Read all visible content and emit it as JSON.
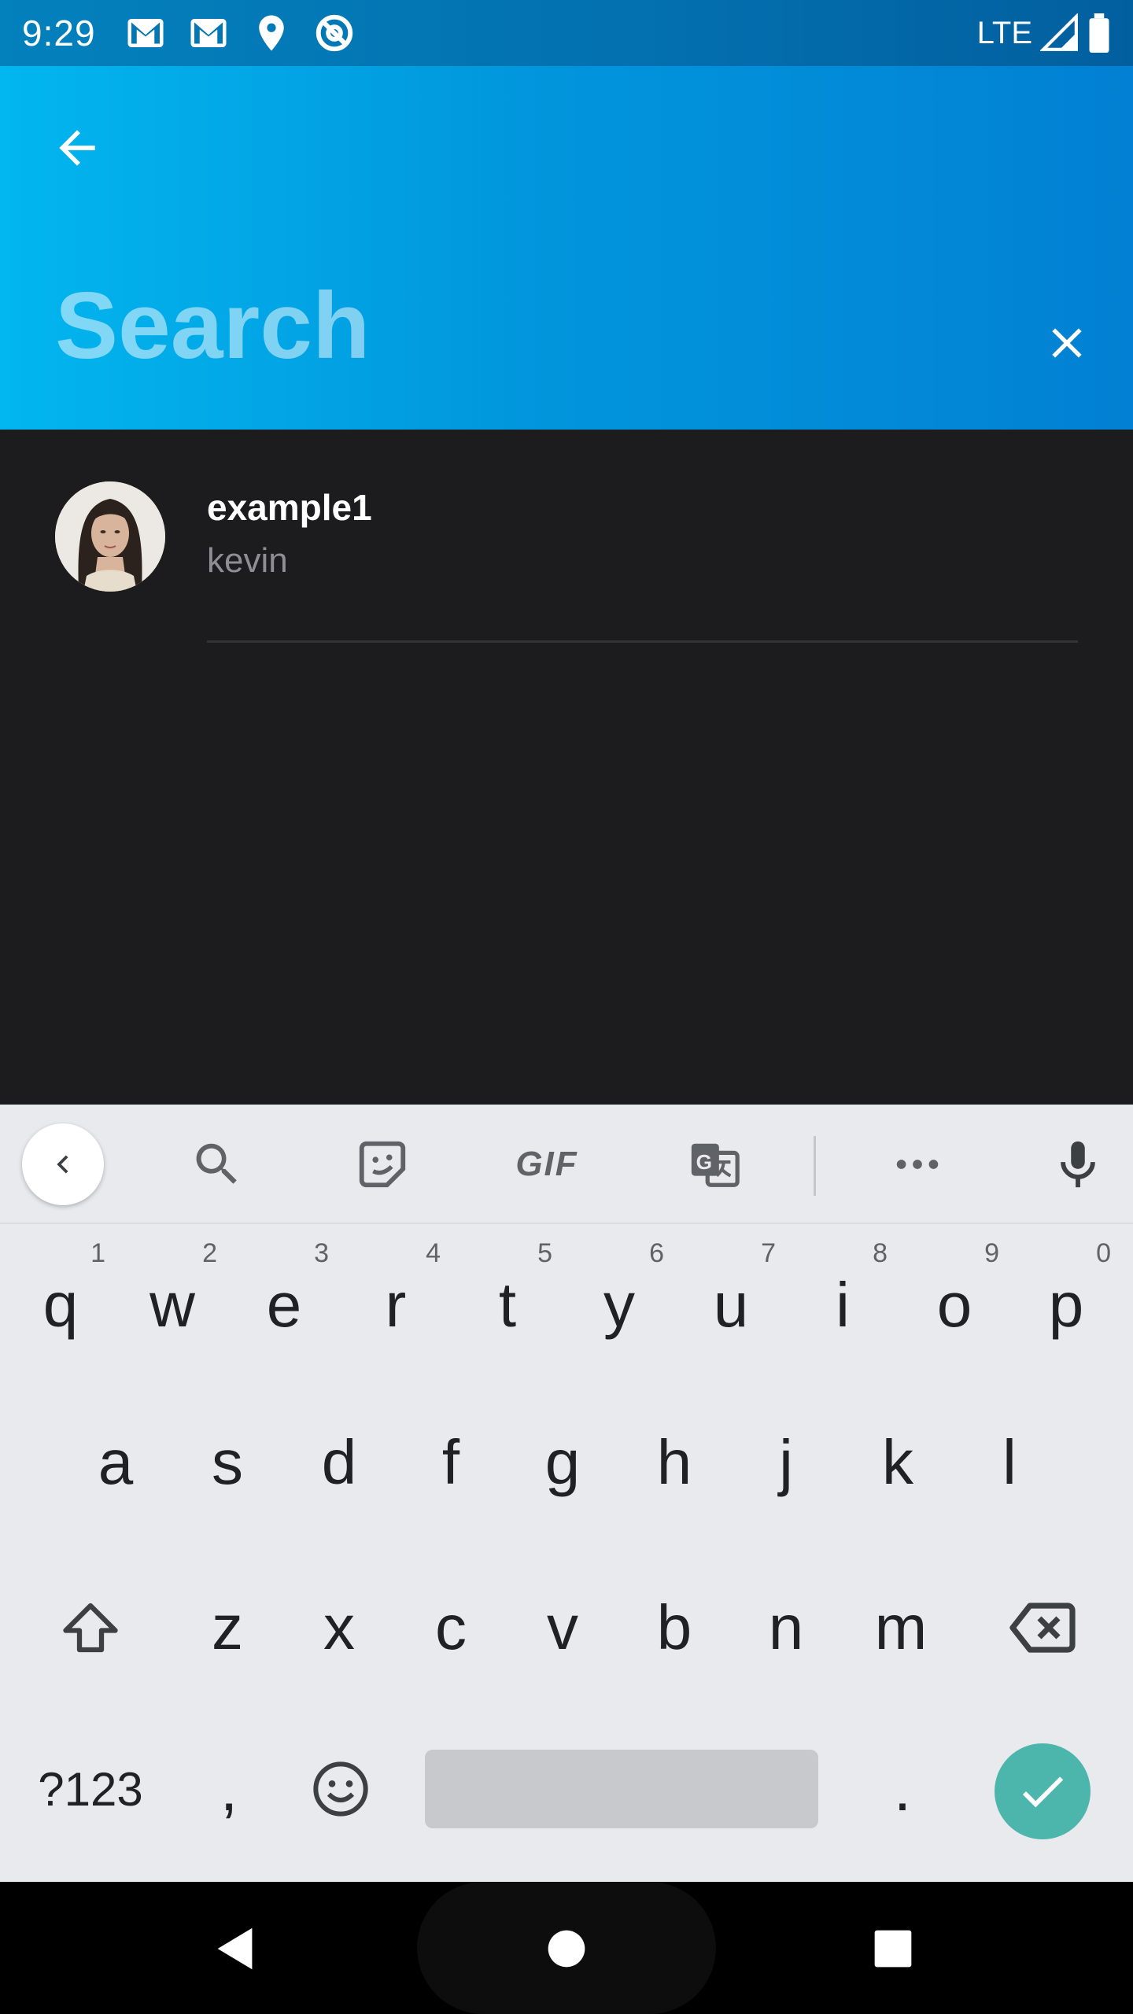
{
  "status_bar": {
    "time": "9:29",
    "network": "LTE",
    "icons": [
      "gmail-icon",
      "gmail-icon",
      "location-icon",
      "at-sign-icon",
      "signal-icon",
      "battery-icon"
    ]
  },
  "app_bar": {
    "search_placeholder": "Search",
    "search_value": "",
    "back_icon": "arrow-left-icon",
    "clear_icon": "close-icon",
    "gradient": [
      "#02b6ef",
      "#0280d3"
    ]
  },
  "results": [
    {
      "name": "example1",
      "username": "kevin",
      "avatar": "avatar"
    }
  ],
  "keyboard": {
    "toolbar": [
      "chevron-left-icon",
      "search-icon",
      "sticker-icon",
      "gif-icon",
      "translate-icon",
      "more-icon",
      "mic-icon"
    ],
    "gif_label": "GIF",
    "row1": [
      {
        "key": "q",
        "hint": "1"
      },
      {
        "key": "w",
        "hint": "2"
      },
      {
        "key": "e",
        "hint": "3"
      },
      {
        "key": "r",
        "hint": "4"
      },
      {
        "key": "t",
        "hint": "5"
      },
      {
        "key": "y",
        "hint": "6"
      },
      {
        "key": "u",
        "hint": "7"
      },
      {
        "key": "i",
        "hint": "8"
      },
      {
        "key": "o",
        "hint": "9"
      },
      {
        "key": "p",
        "hint": "0"
      }
    ],
    "row2": [
      "a",
      "s",
      "d",
      "f",
      "g",
      "h",
      "j",
      "k",
      "l"
    ],
    "row3": [
      "z",
      "x",
      "c",
      "v",
      "b",
      "n",
      "m"
    ],
    "symbols_label": "?123",
    "comma": ",",
    "period": ".",
    "enter_color": "#4db6ac"
  },
  "nav_bar": {
    "buttons": [
      "back-triangle-icon",
      "home-circle-icon",
      "recents-square-icon"
    ]
  }
}
